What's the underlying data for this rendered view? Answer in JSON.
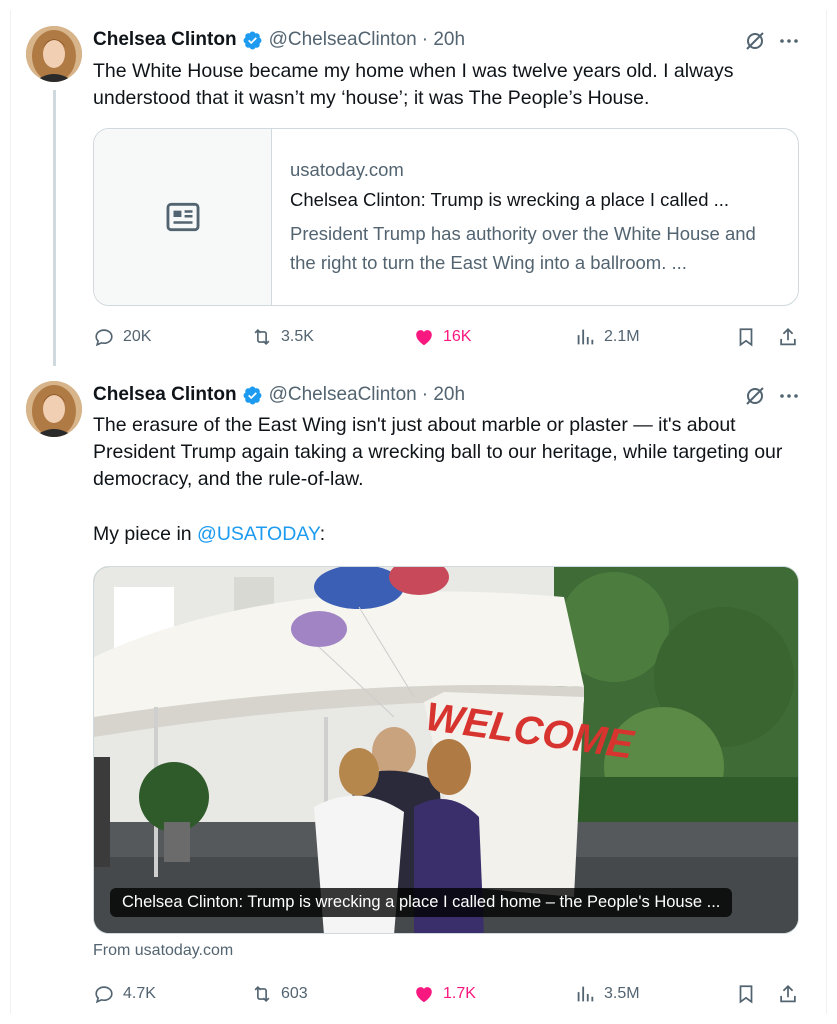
{
  "tweets": [
    {
      "author": {
        "name": "Chelsea Clinton",
        "handle": "@ChelseaClinton",
        "time": "· 20h"
      },
      "text": "The White House became my home when I was twelve years old. I always understood that it wasn’t my ‘house’; it was The People’s House.",
      "link_card": {
        "domain": "usatoday.com",
        "title": "Chelsea Clinton: Trump is wrecking a place I called ...",
        "description": "President Trump has authority over the White House and the right to turn the East Wing into a ballroom. ..."
      },
      "metrics": {
        "replies": "20K",
        "reposts": "3.5K",
        "likes": "16K",
        "views": "2.1M"
      }
    },
    {
      "author": {
        "name": "Chelsea Clinton",
        "handle": "@ChelseaClinton",
        "time": "· 20h"
      },
      "text": "The erasure of the East Wing isn't just about marble or plaster — it's about President Trump again taking a wrecking ball to our heritage, while targeting our democracy, and the rule-of-law.",
      "text2_prefix": "My piece in ",
      "text2_mention": "@USATODAY",
      "text2_suffix": ":",
      "media_caption": "Chelsea Clinton: Trump is wrecking a place I called home – the People's House ...",
      "media_banner": "WELCOME",
      "from": "From usatoday.com",
      "metrics": {
        "replies": "4.7K",
        "reposts": "603",
        "likes": "1.7K",
        "views": "3.5M"
      }
    }
  ],
  "colors": {
    "accent": "#1d9bf0",
    "like": "#f91880",
    "muted": "#536471",
    "text": "#0f1419"
  }
}
